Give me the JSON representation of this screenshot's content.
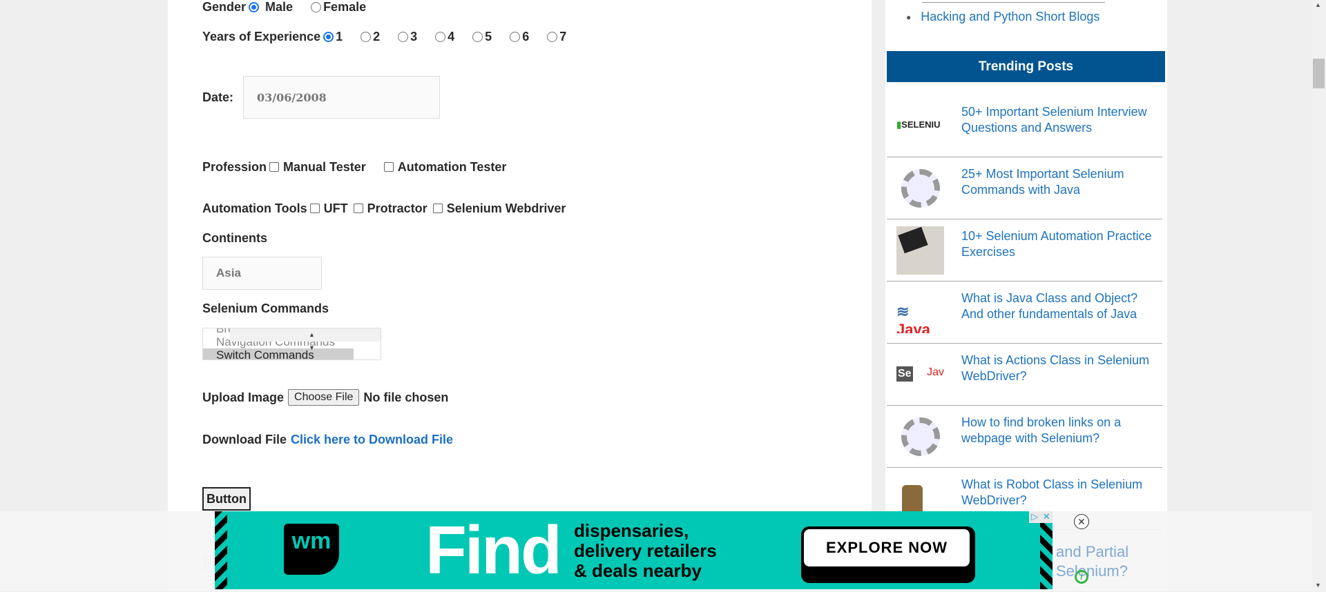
{
  "form": {
    "gender_label": "Gender",
    "gender_options": [
      "Male",
      "Female"
    ],
    "gender_selected": "Male",
    "experience_label": "Years of Experience",
    "experience_options": [
      "1",
      "2",
      "3",
      "4",
      "5",
      "6",
      "7"
    ],
    "experience_selected": "1",
    "date_label": "Date:",
    "date_value": "03/06/2008",
    "profession_label": "Profession",
    "profession_options": [
      "Manual Tester",
      "Automation Tester"
    ],
    "tools_label": "Automation Tools",
    "tools_options": [
      "UFT",
      "Protractor",
      "Selenium Webdriver"
    ],
    "continents_label": "Continents",
    "continents_value": "Asia",
    "commands_label": "Selenium Commands",
    "commands_options": [
      "Browser Commands",
      "Navigation Commands",
      "Switch Commands"
    ],
    "commands_selected": "Switch Commands",
    "upload_label": "Upload Image",
    "choose_file": "Choose File",
    "no_file": "No file chosen",
    "download_label": "Download File",
    "download_link": "Click here to Download File",
    "button_label": "Button",
    "next_heading": "H"
  },
  "sidebar": {
    "blog_link": "Hacking and Python Short Blogs",
    "trending_title": "Trending Posts",
    "posts": [
      "50+ Important Selenium Interview Questions and Answers",
      "25+ Most Important Selenium Commands with Java",
      "10+ Selenium Automation Practice Exercises",
      "What is Java Class and Object? And other fundamentals of Java",
      "What is Actions Class in Selenium WebDriver?",
      "How to find broken links on a webpage with Selenium?",
      "What is Robot Class in Selenium WebDriver?",
      "and Partial Selenium?"
    ]
  },
  "ad": {
    "logo": "wm",
    "headline": "Find",
    "line1": "dispensaries,",
    "line2": "delivery retailers",
    "line3": "& deals nearby",
    "cta": "EXPLORE NOW",
    "brand_color": "#00c8b4"
  }
}
